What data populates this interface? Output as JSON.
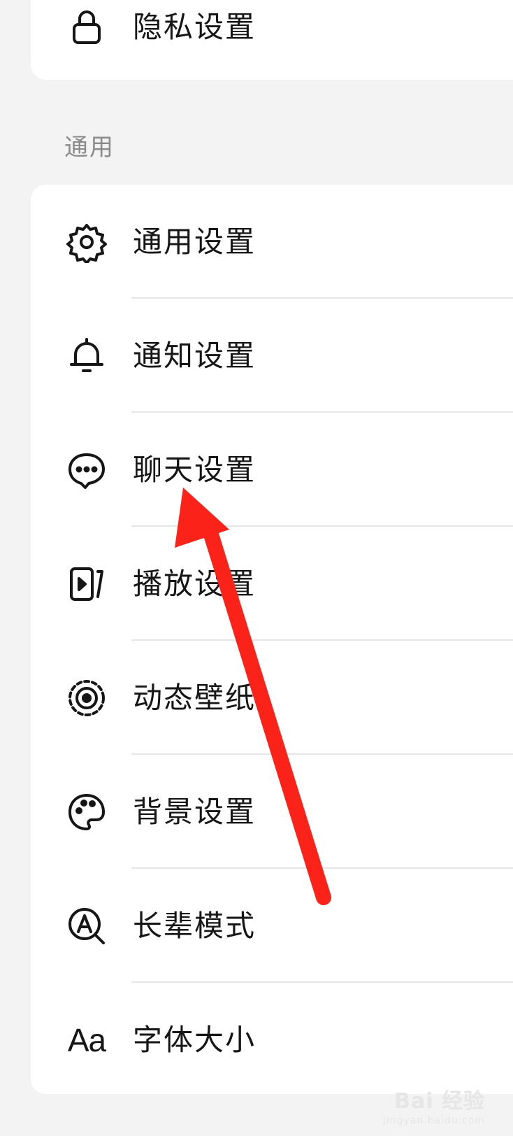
{
  "privacy_item": {
    "label": "隐私设置",
    "icon": "lock-icon"
  },
  "section": {
    "title": "通用"
  },
  "items": [
    {
      "label": "通用设置",
      "icon": "gear-icon"
    },
    {
      "label": "通知设置",
      "icon": "bell-icon"
    },
    {
      "label": "聊天设置",
      "icon": "chat-bubble-icon"
    },
    {
      "label": "播放设置",
      "icon": "play-video-icon"
    },
    {
      "label": "动态壁纸",
      "icon": "live-wallpaper-icon"
    },
    {
      "label": "背景设置",
      "icon": "palette-icon"
    },
    {
      "label": "长辈模式",
      "icon": "elder-mode-icon"
    },
    {
      "label": "字体大小",
      "icon": "font-size-icon",
      "glyph": "Aa"
    }
  ],
  "annotation": {
    "color": "#fa2219",
    "icon": "red-arrow"
  },
  "watermark": {
    "brand": "Bai 经验",
    "url": "jingyan.baidu.com"
  }
}
